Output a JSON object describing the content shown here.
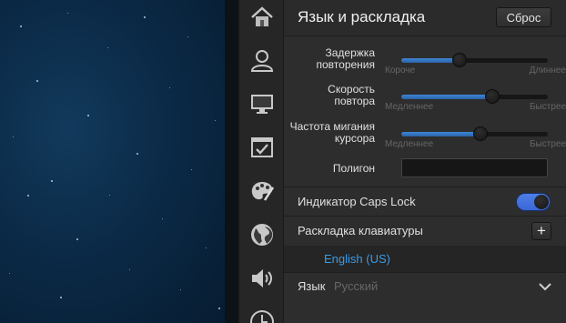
{
  "panel": {
    "title": "Язык и раскладка",
    "reset_label": "Сброс"
  },
  "sidebar": {
    "items": [
      {
        "icon": "home-icon"
      },
      {
        "icon": "user-icon"
      },
      {
        "icon": "monitor-icon"
      },
      {
        "icon": "checkbox-window-icon"
      },
      {
        "icon": "palette-icon"
      },
      {
        "icon": "globe-icon"
      },
      {
        "icon": "speaker-icon"
      },
      {
        "icon": "clock-icon"
      }
    ]
  },
  "sliders": {
    "repeat_delay": {
      "label_line1": "Задержка",
      "label_line2": "повторения",
      "min_label": "Короче",
      "max_label": "Длиннее",
      "value": 0.4
    },
    "repeat_rate": {
      "label_line1": "Скорость",
      "label_line2": "повтора",
      "min_label": "Медленнее",
      "max_label": "Быстрее",
      "value": 0.62
    },
    "cursor_blink": {
      "label_line1": "Частота мигания",
      "label_line2": "курсора",
      "min_label": "Медленнее",
      "max_label": "Быстрее",
      "value": 0.54
    }
  },
  "test_area": {
    "label": "Полигон",
    "value": ""
  },
  "caps_lock": {
    "label": "Индикатор Caps Lock",
    "enabled": true
  },
  "keyboard_layout": {
    "label": "Раскладка клавиатуры",
    "add_label": "+",
    "items": [
      "English (US)"
    ]
  },
  "language": {
    "label": "Язык",
    "value": "Русский"
  },
  "colors": {
    "accent": "#3a9be6",
    "toggle_on": "#4a7de6",
    "slider_fill": "#3a7cc8"
  }
}
